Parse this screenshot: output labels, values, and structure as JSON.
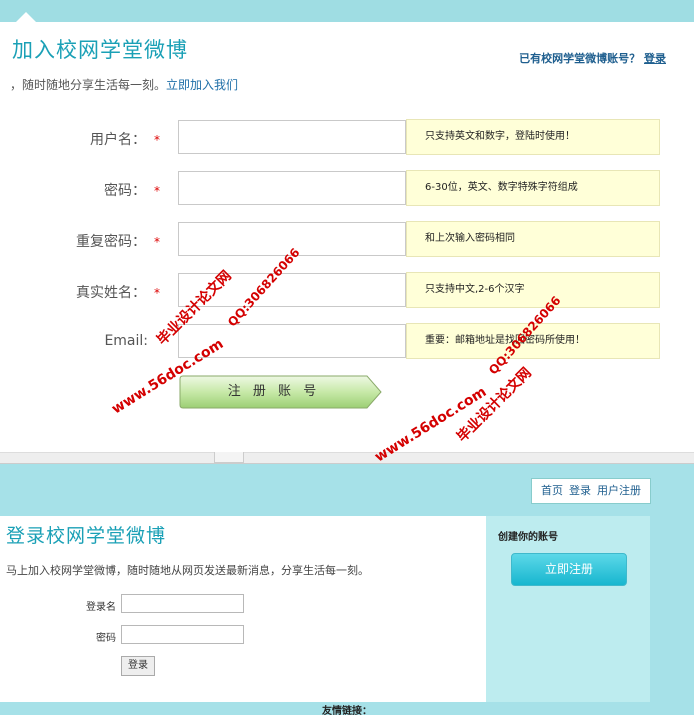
{
  "register": {
    "title": "加入校网学堂微博",
    "subtitle_prefix": "，随时随地分享生活每一刻。",
    "subtitle_link": "立即加入我们",
    "have_account_text": "已有校网学堂微博账号？",
    "login_link": "登录",
    "required_mark": "*",
    "fields": [
      {
        "label": "用户名：",
        "required": true,
        "value": "",
        "hint": "只支持英文和数字，登陆时使用！"
      },
      {
        "label": "密码：",
        "required": true,
        "value": "",
        "hint": "6-30位，英文、数字特殊字符组成"
      },
      {
        "label": "重复密码：",
        "required": true,
        "value": "",
        "hint": "和上次输入密码相同"
      },
      {
        "label": "真实姓名：",
        "required": true,
        "value": "",
        "hint": "只支持中文,2-6个汉字"
      },
      {
        "label": "Email:",
        "required": false,
        "value": "",
        "hint": "重要：邮箱地址是找回密码所使用！"
      }
    ],
    "submit_label": "注 册 账 号"
  },
  "nav": {
    "items": [
      "首页",
      "登录",
      "用户注册"
    ]
  },
  "login": {
    "title": "登录校网学堂微博",
    "subtitle": "马上加入校网学堂微博，随时随地从网页发送最新消息，分享生活每一刻。",
    "username_label": "登录名",
    "password_label": "密码",
    "username_value": "",
    "password_value": "",
    "submit_label": "登录"
  },
  "side": {
    "create_label": "创建你的账号",
    "register_button": "立即注册"
  },
  "footer": {
    "friend_links": "友情链接："
  },
  "watermarks": {
    "site": "www.56doc.com",
    "qq": "QQ:306826066",
    "name": "毕业设计论文网"
  },
  "colors": {
    "accent": "#1aa0b6",
    "band": "#9fdde3",
    "hint_bg": "#ffffd8",
    "required": "#dd0000",
    "watermark": "#d40000"
  }
}
